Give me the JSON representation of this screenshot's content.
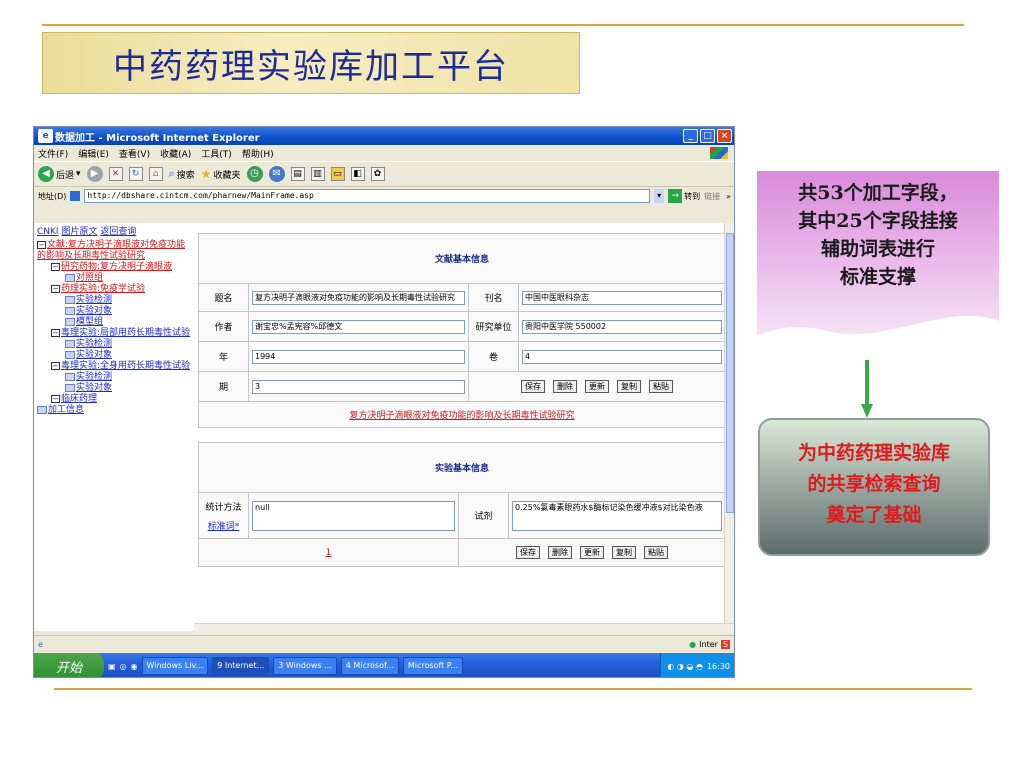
{
  "slide": {
    "title": "中药药理实验库加工平台",
    "note1_lines": [
      "共53个加工字段，",
      "其中25个字段挂接",
      "辅助词表进行",
      "标准支撑"
    ],
    "note2_lines": [
      "为中药药理实验库",
      "的共享检索查询",
      "奠定了基础"
    ],
    "colors": {
      "title_text": "#1c2a9a",
      "note2_text": "#e01a1a",
      "rule_lines": "#d9a441"
    }
  },
  "browser": {
    "window_title": "数据加工 - Microsoft Internet Explorer",
    "menu": [
      "文件(F)",
      "编辑(E)",
      "查看(V)",
      "收藏(A)",
      "工具(T)",
      "帮助(H)"
    ],
    "toolbar": {
      "back": "后退",
      "search": "搜索",
      "favorites": "收藏夹"
    },
    "address_label": "地址(D)",
    "address": "http://dbshare.cintcm.com/pharnew/MainFrame.asp",
    "go": "转到",
    "links": "链接",
    "status_zone": "Inter"
  },
  "tree": {
    "top_links": [
      "CNKI",
      "图片原文",
      "返回查询"
    ],
    "nodes": [
      {
        "prefix": "box",
        "indent": 0,
        "text": "文献:复方决明子滴眼液对免疫功能的影响及长期毒性试验研究",
        "style": "red"
      },
      {
        "prefix": "box",
        "indent": 1,
        "text": "研究药物:复方决明子滴眼液",
        "style": "red"
      },
      {
        "prefix": "doc",
        "indent": 2,
        "text": "对照组",
        "style": "red"
      },
      {
        "prefix": "box",
        "indent": 1,
        "text": "药理实验:免疫学试验",
        "style": "red"
      },
      {
        "prefix": "doc",
        "indent": 2,
        "text": "实验检测",
        "style": "blue"
      },
      {
        "prefix": "doc",
        "indent": 2,
        "text": "实验对象",
        "style": "blue"
      },
      {
        "prefix": "doc",
        "indent": 2,
        "text": "模型组",
        "style": "blue"
      },
      {
        "prefix": "box",
        "indent": 1,
        "text": "毒理实验:局部用药长期毒性试验",
        "style": "blue"
      },
      {
        "prefix": "doc",
        "indent": 2,
        "text": "实验检测",
        "style": "blue"
      },
      {
        "prefix": "doc",
        "indent": 2,
        "text": "实验对象",
        "style": "blue"
      },
      {
        "prefix": "box",
        "indent": 1,
        "text": "毒理实验:全身用药长期毒性试验",
        "style": "blue"
      },
      {
        "prefix": "doc",
        "indent": 2,
        "text": "实验检测",
        "style": "blue"
      },
      {
        "prefix": "doc",
        "indent": 2,
        "text": "实验对象",
        "style": "blue"
      },
      {
        "prefix": "box",
        "indent": 1,
        "text": "临床药理",
        "style": "blue"
      },
      {
        "prefix": "doc",
        "indent": 0,
        "text": "加工信息",
        "style": "blue"
      }
    ]
  },
  "form": {
    "section1_title": "文献基本信息",
    "title_label": "题名",
    "title_value": "复方决明子滴眼液对免疫功能的影响及长期毒性试验研究",
    "journal_label": "刊名",
    "journal_value": "中国中医眼科杂志",
    "author_label": "作者",
    "author_value": "谢宝忠%孟宪容%邱德文",
    "unit_label": "研究单位",
    "unit_value": "贵阳中医学院 550002",
    "year_label": "年",
    "year_value": "1994",
    "volume_label": "卷",
    "volume_value": "4",
    "issue_label": "期",
    "issue_value": "3",
    "buttons": [
      "保存",
      "删除",
      "更新",
      "复制",
      "粘贴"
    ],
    "doc_link": "复方决明子滴眼液对免疫功能的影响及长期毒性试验研究",
    "section2_title": "实验基本信息",
    "stat_label": "统计方法",
    "stat_link": "标准词*",
    "stat_value": "null",
    "reagent_label": "试剂",
    "reagent_value": "0.25%氯毒素眼药水$酶标记染色缓冲液$对比染色液",
    "page_number": "1",
    "buttons2": [
      "保存",
      "删除",
      "更新",
      "复制",
      "粘贴"
    ]
  },
  "taskbar": {
    "start": "开始",
    "tasks": [
      "Windows Liv...",
      "9 Internet...",
      "3 Windows ...",
      "4 Microsof...",
      "Microsoft P..."
    ],
    "clock": "16:30"
  }
}
